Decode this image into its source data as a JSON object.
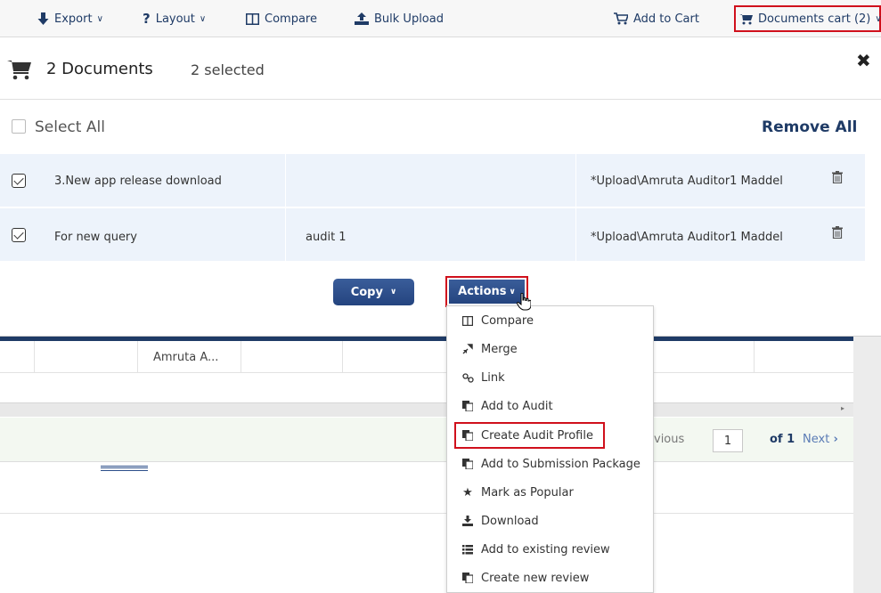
{
  "toolbar": {
    "export_label": "Export",
    "layout_label": "Layout",
    "compare_label": "Compare",
    "bulk_upload_label": "Bulk Upload",
    "add_to_cart_label": "Add to Cart",
    "documents_cart_label": "Documents cart (2)"
  },
  "cart": {
    "title": "2 Documents",
    "selected": "2 selected",
    "select_all_label": "Select All",
    "remove_all_label": "Remove All",
    "rows": [
      {
        "name": "3.New app release download",
        "audit": "",
        "path": "*Upload\\Amruta Auditor1 Maddel",
        "checked": true
      },
      {
        "name": "For new query",
        "audit": "audit 1",
        "path": "*Upload\\Amruta Auditor1 Maddel",
        "checked": true
      }
    ],
    "copy_label": "Copy",
    "actions_label": "Actions"
  },
  "actions_menu": {
    "items": [
      {
        "label": "Compare",
        "icon": "columns-icon"
      },
      {
        "label": "Merge",
        "icon": "merge-icon"
      },
      {
        "label": "Link",
        "icon": "link-icon"
      },
      {
        "label": "Add to Audit",
        "icon": "copy-icon"
      },
      {
        "label": "Create Audit Profile",
        "icon": "copy-icon"
      },
      {
        "label": "Add to Submission Package",
        "icon": "copy-icon"
      },
      {
        "label": "Mark as Popular",
        "icon": "star-icon"
      },
      {
        "label": "Download",
        "icon": "download-icon"
      },
      {
        "label": "Add to existing review",
        "icon": "list-icon"
      },
      {
        "label": "Create new review",
        "icon": "copy-icon"
      }
    ]
  },
  "background": {
    "cell_text": "Amruta A...",
    "prev_label": "vious",
    "page_value": "1",
    "of_label": "of 1",
    "next_label": "Next"
  },
  "colors": {
    "accent": "#1f3b66",
    "highlight_border": "#d0101c",
    "row_bg": "#edf3fb"
  }
}
